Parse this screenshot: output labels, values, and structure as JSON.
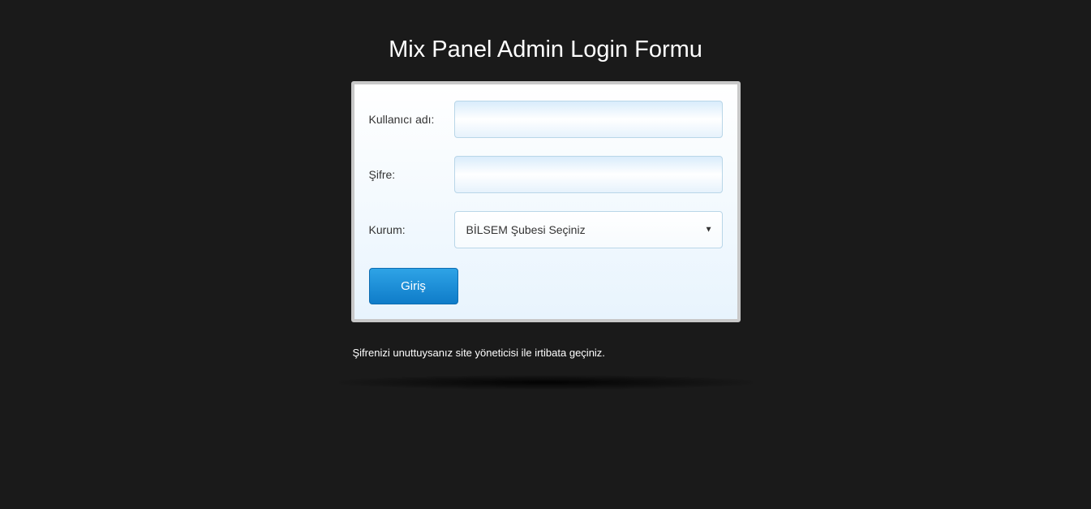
{
  "title": "Mix Panel Admin Login Formu",
  "form": {
    "username_label": "Kullanıcı adı:",
    "username_value": "",
    "password_label": "Şifre:",
    "password_value": "",
    "institution_label": "Kurum:",
    "institution_selected": "BİLSEM Şubesi Seçiniz",
    "submit_label": "Giriş"
  },
  "help_text": "Şifrenizi unuttuysanız site yöneticisi ile irtibata geçiniz."
}
